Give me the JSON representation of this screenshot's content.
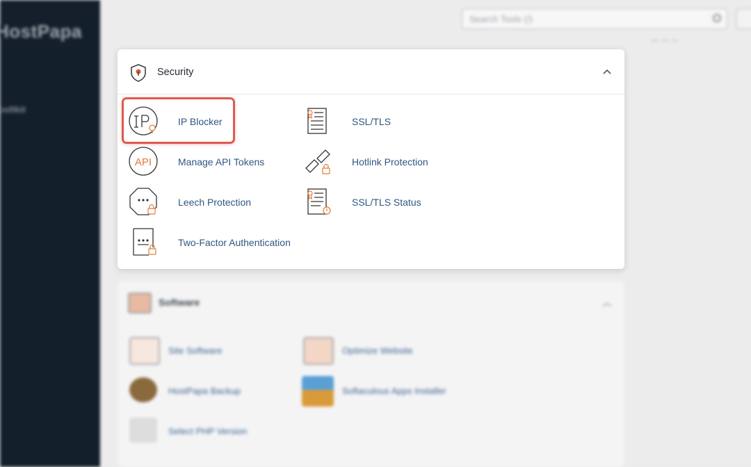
{
  "background": {
    "brand": "HostPapa",
    "sidebar_items": [
      "",
      "ooltkit"
    ],
    "search_placeholder": "Search Tools (/)",
    "header_links": "— — —",
    "software_panel": {
      "title": "Software",
      "items": [
        {
          "label": "Site Software"
        },
        {
          "label": "Optimize Website"
        },
        {
          "label": "HostPapa Backup"
        },
        {
          "label": "Softaculous Apps Installer"
        },
        {
          "label": "Select PHP Version"
        }
      ]
    }
  },
  "security": {
    "title": "Security",
    "tools": [
      {
        "label": "IP Blocker",
        "icon": "ip-blocker-icon"
      },
      {
        "label": "SSL/TLS",
        "icon": "ssl-tls-icon"
      },
      {
        "label": "Manage API Tokens",
        "icon": "api-tokens-icon"
      },
      {
        "label": "Hotlink Protection",
        "icon": "hotlink-protection-icon"
      },
      {
        "label": "Leech Protection",
        "icon": "leech-protection-icon"
      },
      {
        "label": "SSL/TLS Status",
        "icon": "ssl-tls-status-icon"
      },
      {
        "label": "Two-Factor Authentication",
        "icon": "two-factor-icon"
      }
    ]
  },
  "colors": {
    "link": "#2f5682",
    "accent_orange": "#e07b39",
    "highlight_red": "#de5a4e",
    "sidebar_bg": "#13202b"
  }
}
